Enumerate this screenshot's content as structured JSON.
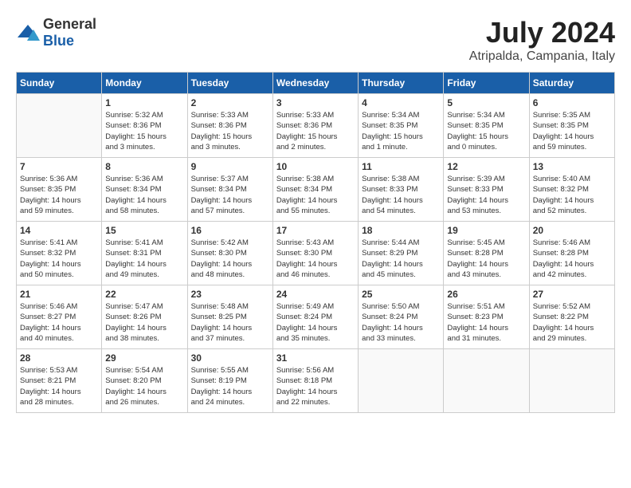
{
  "header": {
    "logo": {
      "general": "General",
      "blue": "Blue"
    },
    "title": "July 2024",
    "location": "Atripalda, Campania, Italy"
  },
  "calendar": {
    "weekdays": [
      "Sunday",
      "Monday",
      "Tuesday",
      "Wednesday",
      "Thursday",
      "Friday",
      "Saturday"
    ],
    "weeks": [
      [
        {
          "day": "",
          "info": ""
        },
        {
          "day": "1",
          "info": "Sunrise: 5:32 AM\nSunset: 8:36 PM\nDaylight: 15 hours\nand 3 minutes."
        },
        {
          "day": "2",
          "info": "Sunrise: 5:33 AM\nSunset: 8:36 PM\nDaylight: 15 hours\nand 3 minutes."
        },
        {
          "day": "3",
          "info": "Sunrise: 5:33 AM\nSunset: 8:36 PM\nDaylight: 15 hours\nand 2 minutes."
        },
        {
          "day": "4",
          "info": "Sunrise: 5:34 AM\nSunset: 8:35 PM\nDaylight: 15 hours\nand 1 minute."
        },
        {
          "day": "5",
          "info": "Sunrise: 5:34 AM\nSunset: 8:35 PM\nDaylight: 15 hours\nand 0 minutes."
        },
        {
          "day": "6",
          "info": "Sunrise: 5:35 AM\nSunset: 8:35 PM\nDaylight: 14 hours\nand 59 minutes."
        }
      ],
      [
        {
          "day": "7",
          "info": "Sunrise: 5:36 AM\nSunset: 8:35 PM\nDaylight: 14 hours\nand 59 minutes."
        },
        {
          "day": "8",
          "info": "Sunrise: 5:36 AM\nSunset: 8:34 PM\nDaylight: 14 hours\nand 58 minutes."
        },
        {
          "day": "9",
          "info": "Sunrise: 5:37 AM\nSunset: 8:34 PM\nDaylight: 14 hours\nand 57 minutes."
        },
        {
          "day": "10",
          "info": "Sunrise: 5:38 AM\nSunset: 8:34 PM\nDaylight: 14 hours\nand 55 minutes."
        },
        {
          "day": "11",
          "info": "Sunrise: 5:38 AM\nSunset: 8:33 PM\nDaylight: 14 hours\nand 54 minutes."
        },
        {
          "day": "12",
          "info": "Sunrise: 5:39 AM\nSunset: 8:33 PM\nDaylight: 14 hours\nand 53 minutes."
        },
        {
          "day": "13",
          "info": "Sunrise: 5:40 AM\nSunset: 8:32 PM\nDaylight: 14 hours\nand 52 minutes."
        }
      ],
      [
        {
          "day": "14",
          "info": "Sunrise: 5:41 AM\nSunset: 8:32 PM\nDaylight: 14 hours\nand 50 minutes."
        },
        {
          "day": "15",
          "info": "Sunrise: 5:41 AM\nSunset: 8:31 PM\nDaylight: 14 hours\nand 49 minutes."
        },
        {
          "day": "16",
          "info": "Sunrise: 5:42 AM\nSunset: 8:30 PM\nDaylight: 14 hours\nand 48 minutes."
        },
        {
          "day": "17",
          "info": "Sunrise: 5:43 AM\nSunset: 8:30 PM\nDaylight: 14 hours\nand 46 minutes."
        },
        {
          "day": "18",
          "info": "Sunrise: 5:44 AM\nSunset: 8:29 PM\nDaylight: 14 hours\nand 45 minutes."
        },
        {
          "day": "19",
          "info": "Sunrise: 5:45 AM\nSunset: 8:28 PM\nDaylight: 14 hours\nand 43 minutes."
        },
        {
          "day": "20",
          "info": "Sunrise: 5:46 AM\nSunset: 8:28 PM\nDaylight: 14 hours\nand 42 minutes."
        }
      ],
      [
        {
          "day": "21",
          "info": "Sunrise: 5:46 AM\nSunset: 8:27 PM\nDaylight: 14 hours\nand 40 minutes."
        },
        {
          "day": "22",
          "info": "Sunrise: 5:47 AM\nSunset: 8:26 PM\nDaylight: 14 hours\nand 38 minutes."
        },
        {
          "day": "23",
          "info": "Sunrise: 5:48 AM\nSunset: 8:25 PM\nDaylight: 14 hours\nand 37 minutes."
        },
        {
          "day": "24",
          "info": "Sunrise: 5:49 AM\nSunset: 8:24 PM\nDaylight: 14 hours\nand 35 minutes."
        },
        {
          "day": "25",
          "info": "Sunrise: 5:50 AM\nSunset: 8:24 PM\nDaylight: 14 hours\nand 33 minutes."
        },
        {
          "day": "26",
          "info": "Sunrise: 5:51 AM\nSunset: 8:23 PM\nDaylight: 14 hours\nand 31 minutes."
        },
        {
          "day": "27",
          "info": "Sunrise: 5:52 AM\nSunset: 8:22 PM\nDaylight: 14 hours\nand 29 minutes."
        }
      ],
      [
        {
          "day": "28",
          "info": "Sunrise: 5:53 AM\nSunset: 8:21 PM\nDaylight: 14 hours\nand 28 minutes."
        },
        {
          "day": "29",
          "info": "Sunrise: 5:54 AM\nSunset: 8:20 PM\nDaylight: 14 hours\nand 26 minutes."
        },
        {
          "day": "30",
          "info": "Sunrise: 5:55 AM\nSunset: 8:19 PM\nDaylight: 14 hours\nand 24 minutes."
        },
        {
          "day": "31",
          "info": "Sunrise: 5:56 AM\nSunset: 8:18 PM\nDaylight: 14 hours\nand 22 minutes."
        },
        {
          "day": "",
          "info": ""
        },
        {
          "day": "",
          "info": ""
        },
        {
          "day": "",
          "info": ""
        }
      ]
    ]
  }
}
